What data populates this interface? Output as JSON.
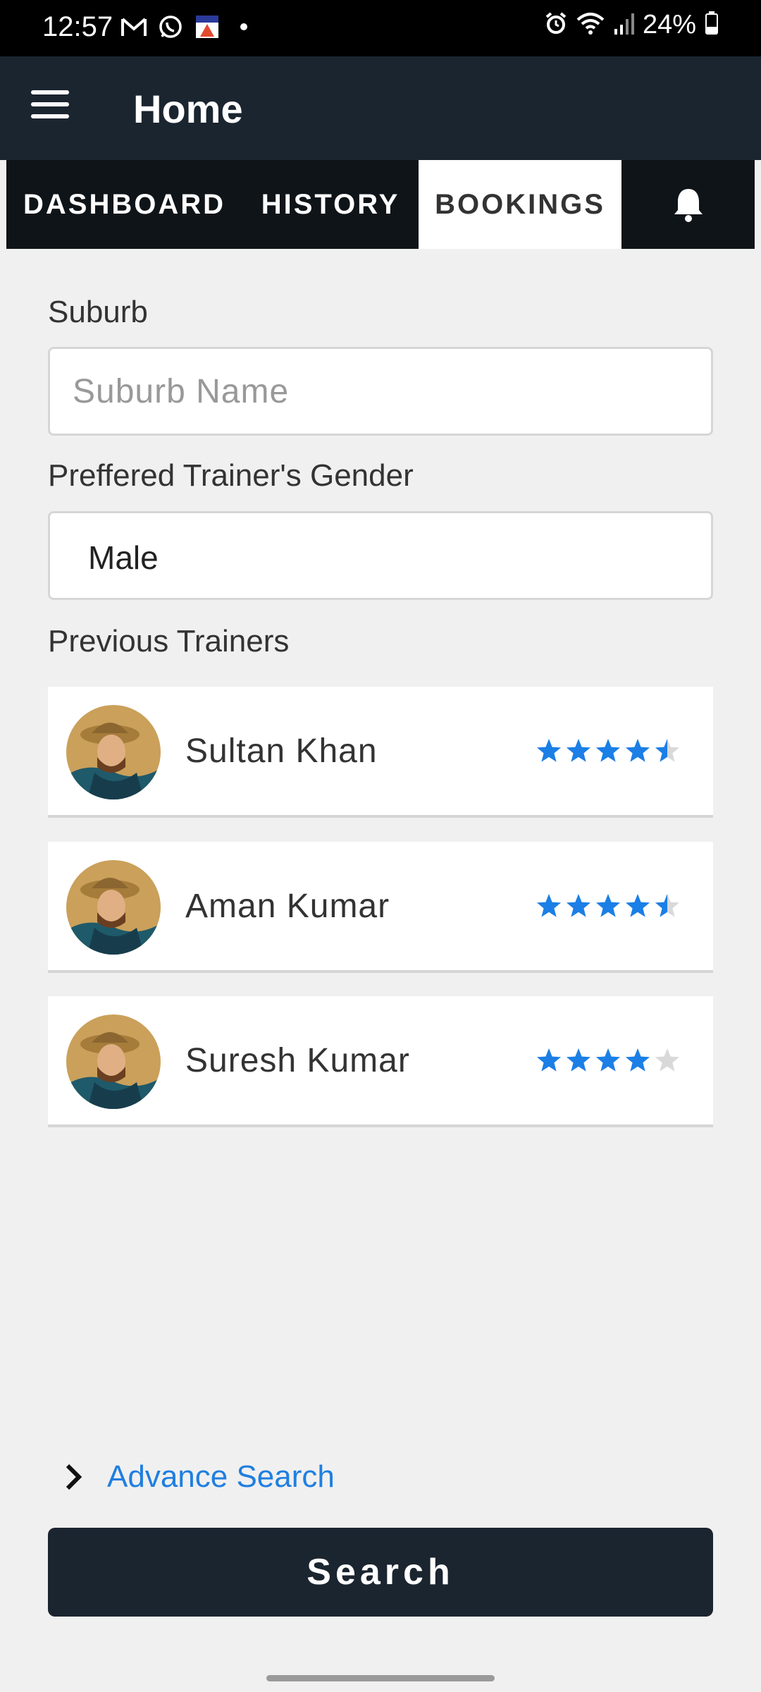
{
  "status_bar": {
    "time": "12:57",
    "battery": "24%",
    "left_icons": [
      "gmail-icon",
      "whatsapp-icon",
      "app-icon",
      "dot-icon"
    ],
    "right_icons": [
      "alarm-icon",
      "wifi-icon",
      "signal-icon",
      "battery-icon"
    ]
  },
  "app_bar": {
    "title": "Home"
  },
  "tabs": [
    {
      "label": "DASHBOARD"
    },
    {
      "label": "HISTORY"
    },
    {
      "label": "BOOKINGS",
      "selected": true
    },
    {
      "icon": "bell-icon"
    }
  ],
  "form": {
    "suburb_label": "Suburb",
    "suburb_placeholder": "Suburb Name",
    "gender_label": "Preffered Trainer's Gender",
    "gender_value": "Male"
  },
  "previous_trainers": {
    "title": "Previous Trainers",
    "items": [
      {
        "name": "Sultan Khan",
        "rating": 4.5
      },
      {
        "name": "Aman Kumar",
        "rating": 4.5
      },
      {
        "name": "Suresh Kumar",
        "rating": 4
      }
    ]
  },
  "advance_search": {
    "label": "Advance Search"
  },
  "search_button": {
    "label": "Search"
  },
  "colors": {
    "app_bar": "#1b2530",
    "tab_bar": "#0f1418",
    "accent_blue": "#1f7fe0",
    "star_blue": "#1b7fe6",
    "background": "#f0f0f0"
  }
}
